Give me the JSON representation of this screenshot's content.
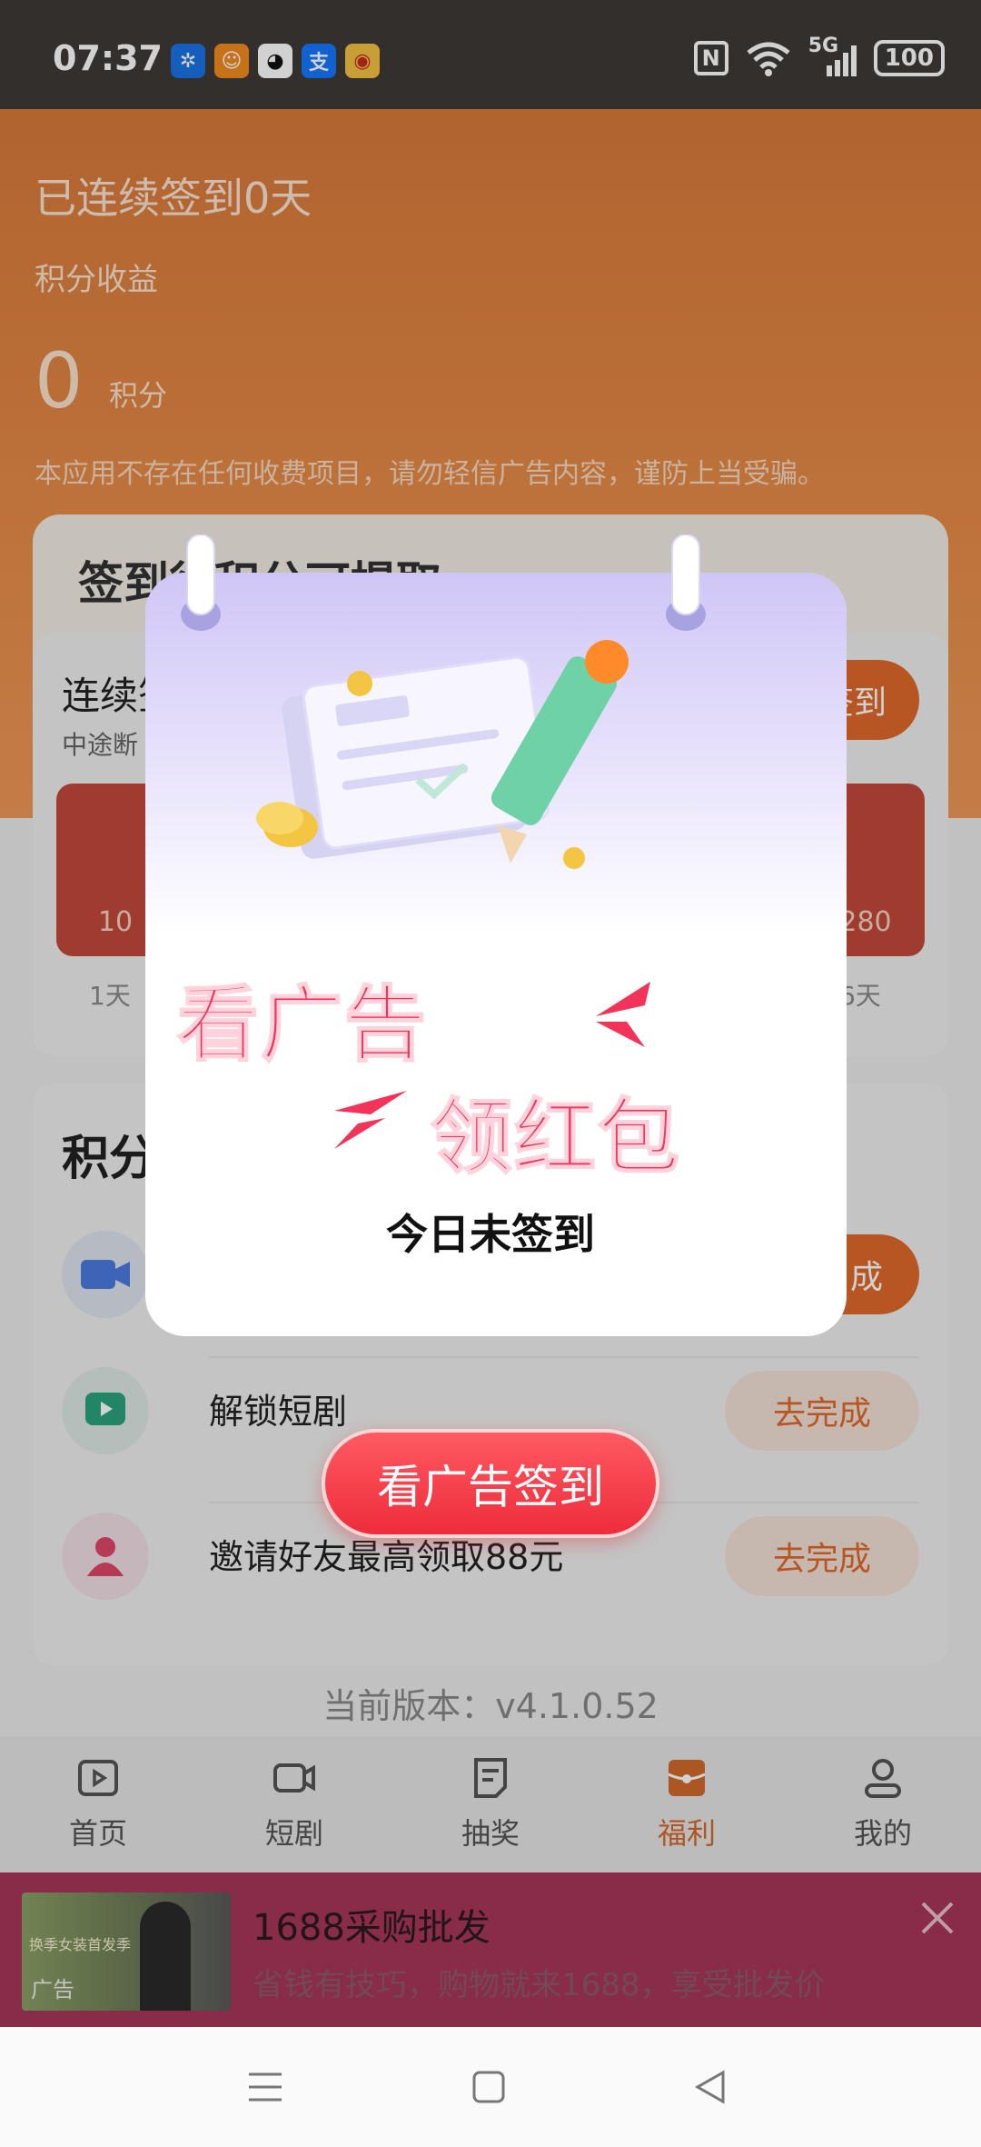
{
  "status_bar": {
    "time": "07:37",
    "app_icons": [
      {
        "name": "pinwheel-icon",
        "glyph": "✲",
        "color": "#1a73e8"
      },
      {
        "name": "mascot-icon",
        "glyph": "☺",
        "color": "#f28c1e"
      },
      {
        "name": "qq-penguin-icon",
        "glyph": "◕",
        "color": "#222222"
      },
      {
        "name": "alipay-icon",
        "glyph": "支",
        "color": "#1677ff"
      },
      {
        "name": "weibo-icon",
        "glyph": "◉",
        "color": "#e8a21e"
      }
    ],
    "nfc": "N",
    "signal_label": "5G",
    "battery": "100"
  },
  "header": {
    "streak_text": "已连续签到0天",
    "earnings_label": "积分收益",
    "points_value": "0",
    "points_unit": "积分",
    "notice": "本应用不存在任何收费项目，请勿轻信广告内容，谨防上当受骗。"
  },
  "sign_card": {
    "title": "签到得积分可提取",
    "continuous_label": "连续签",
    "continuous_sub": "中途断",
    "sign_button": "签到",
    "red_packets": [
      {
        "amount": "10",
        "day": "1天"
      },
      {
        "amount": "280",
        "day": "6天"
      }
    ]
  },
  "tasks": {
    "title": "积分",
    "items": [
      {
        "name": "",
        "button": "成"
      },
      {
        "name": "解锁短剧",
        "button": "去完成"
      },
      {
        "name": "邀请好友最高领取88元",
        "button": "去完成"
      }
    ]
  },
  "version": "当前版本：v4.1.0.52",
  "bottom_nav": {
    "items": [
      {
        "label": "首页",
        "icon": "play-square-icon"
      },
      {
        "label": "短剧",
        "icon": "video-camera-icon"
      },
      {
        "label": "抽奖",
        "icon": "lottery-ticket-icon"
      },
      {
        "label": "福利",
        "icon": "gift-bag-icon"
      },
      {
        "label": "我的",
        "icon": "user-icon"
      }
    ],
    "active_index": 3
  },
  "ad": {
    "thumb_tag": "广告",
    "thumb_text": "换季女装首发季",
    "title": "1688采购批发",
    "description": "省钱有技巧，购物就来1688，享受批发价"
  },
  "dialog": {
    "slogan_line1": "看广告",
    "slogan_line2": "领红包",
    "status": "今日未签到",
    "action_button": "看广告签到"
  },
  "colors": {
    "brand_orange": "#e06a2a",
    "active_nav": "#d26a2c",
    "slogan_red": "#f2345a",
    "ad_background": "#a6365a"
  }
}
